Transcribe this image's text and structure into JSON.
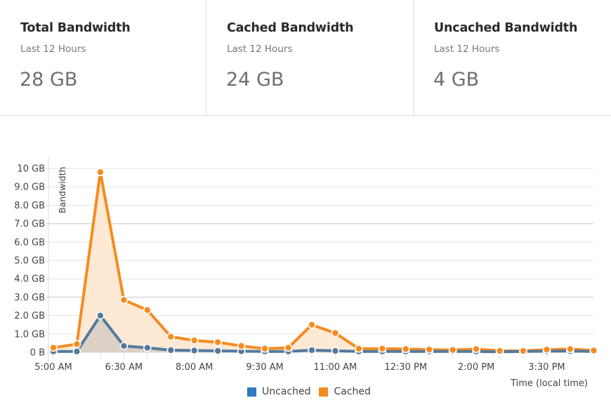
{
  "stats": [
    {
      "title": "Total Bandwidth",
      "subtitle": "Last 12 Hours",
      "value": "28 GB"
    },
    {
      "title": "Cached Bandwidth",
      "subtitle": "Last 12 Hours",
      "value": "24 GB"
    },
    {
      "title": "Uncached Bandwidth",
      "subtitle": "Last 12 Hours",
      "value": "4 GB"
    }
  ],
  "colors": {
    "cached": "#f68b1f",
    "cached_fill": "#fde8d2",
    "uncached": "#547a9c",
    "uncached_fill": "#d9d0c6",
    "uncached_legend": "#2f7bc0",
    "grid": "#dddddd"
  },
  "chart_data": {
    "type": "area",
    "title": "",
    "xlabel": "Time (local time)",
    "ylabel": "Bandwidth",
    "ylim": [
      0,
      10
    ],
    "y_unit": "GB",
    "y_ticks": [
      "0 B",
      "1.0 GB",
      "2.0 GB",
      "3.0 GB",
      "4.0 GB",
      "5.0 GB",
      "6.0 GB",
      "7.0 GB",
      "8.0 GB",
      "9.0 GB",
      "10 GB"
    ],
    "x": [
      "5:00 AM",
      "5:30 AM",
      "6:00 AM",
      "6:30 AM",
      "7:00 AM",
      "7:30 AM",
      "8:00 AM",
      "8:30 AM",
      "9:00 AM",
      "9:30 AM",
      "10:00 AM",
      "10:30 AM",
      "11:00 AM",
      "11:30 AM",
      "12:00 PM",
      "12:30 PM",
      "1:00 PM",
      "1:30 PM",
      "2:00 PM",
      "2:30 PM",
      "3:00 PM",
      "3:30 PM",
      "4:00 PM",
      "4:30 PM"
    ],
    "x_tick_labels": [
      "5:00 AM",
      "6:30 AM",
      "8:00 AM",
      "9:30 AM",
      "11:00 AM",
      "12:30 PM",
      "2:00 PM",
      "3:30 PM"
    ],
    "grid": true,
    "legend_position": "bottom",
    "series": [
      {
        "name": "Uncached",
        "values": [
          0.05,
          0.05,
          2.0,
          0.35,
          0.25,
          0.12,
          0.1,
          0.08,
          0.06,
          0.05,
          0.05,
          0.12,
          0.08,
          0.05,
          0.05,
          0.05,
          0.05,
          0.05,
          0.05,
          0.03,
          0.05,
          0.06,
          0.07,
          0.05
        ]
      },
      {
        "name": "Cached",
        "values": [
          0.25,
          0.45,
          9.8,
          2.85,
          2.3,
          0.85,
          0.65,
          0.55,
          0.35,
          0.2,
          0.25,
          1.5,
          1.05,
          0.2,
          0.2,
          0.18,
          0.15,
          0.13,
          0.18,
          0.08,
          0.08,
          0.15,
          0.18,
          0.1
        ]
      }
    ]
  },
  "legend": [
    {
      "label": "Uncached"
    },
    {
      "label": "Cached"
    }
  ]
}
